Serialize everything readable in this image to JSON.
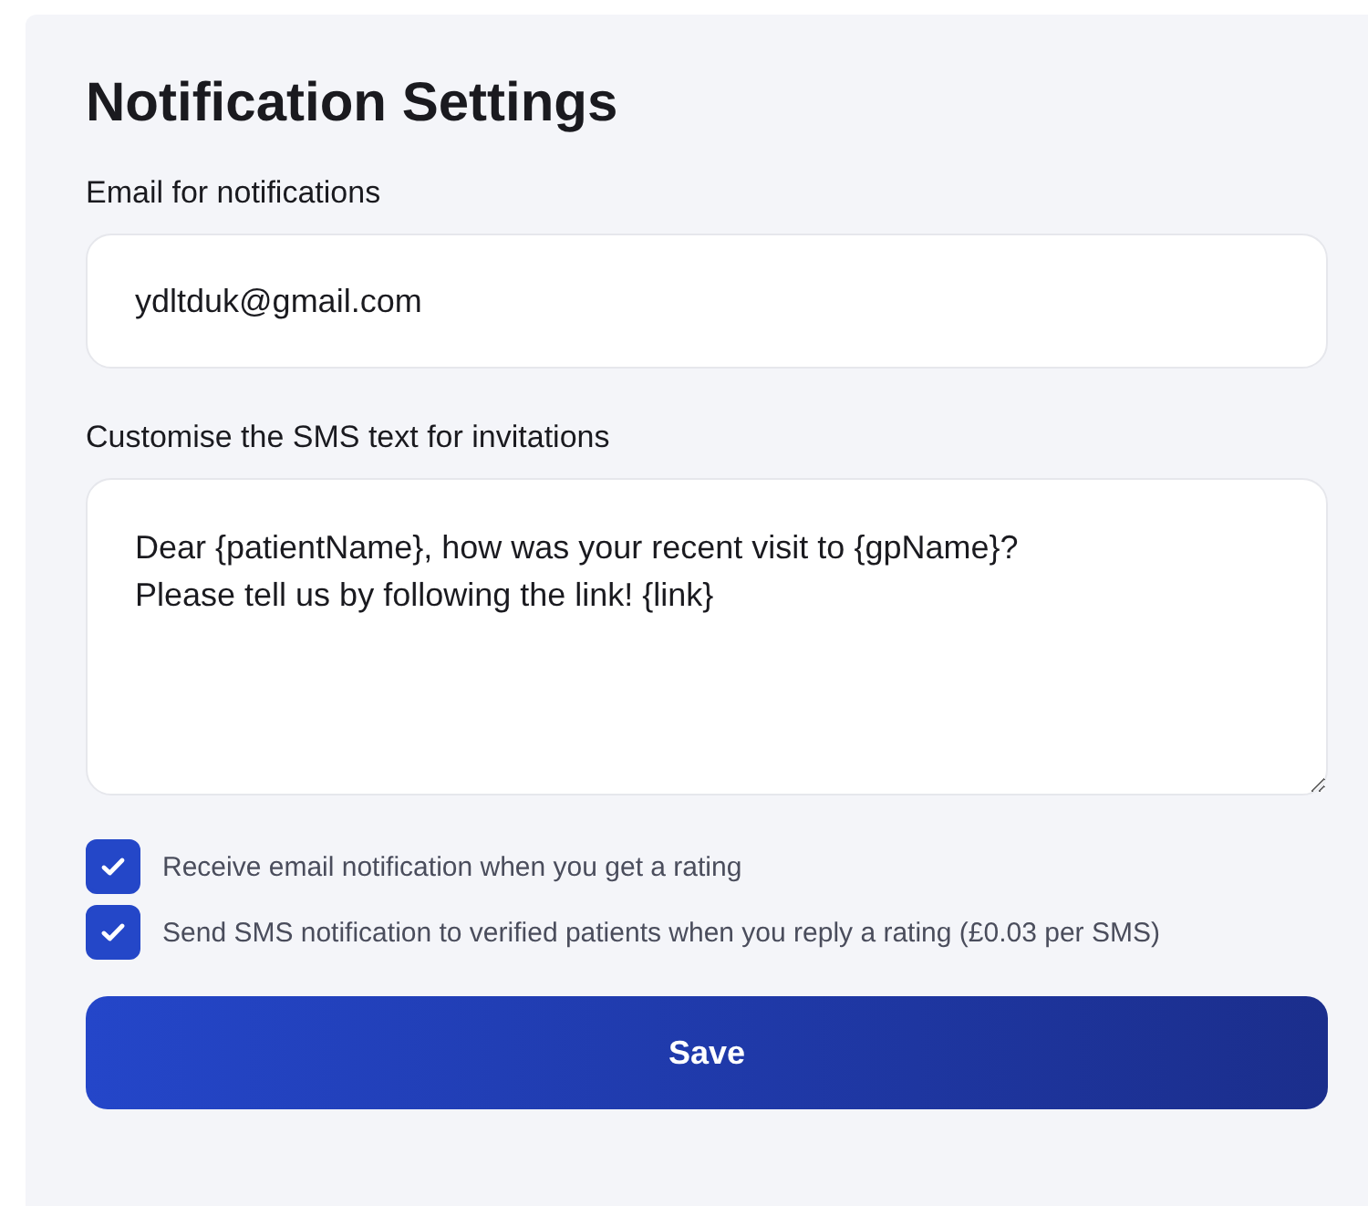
{
  "title": "Notification Settings",
  "email": {
    "label": "Email for notifications",
    "value": "ydltduk@gmail.com"
  },
  "sms": {
    "label": "Customise the SMS text for invitations",
    "value": "Dear {patientName}, how was your recent visit to {gpName}?\nPlease tell us by following the link! {link}"
  },
  "options": [
    {
      "label": "Receive email notification when you get a rating",
      "checked": true
    },
    {
      "label": "Send SMS notification to verified patients when you reply a rating (£0.03 per SMS)",
      "checked": true
    }
  ],
  "save_button": "Save"
}
